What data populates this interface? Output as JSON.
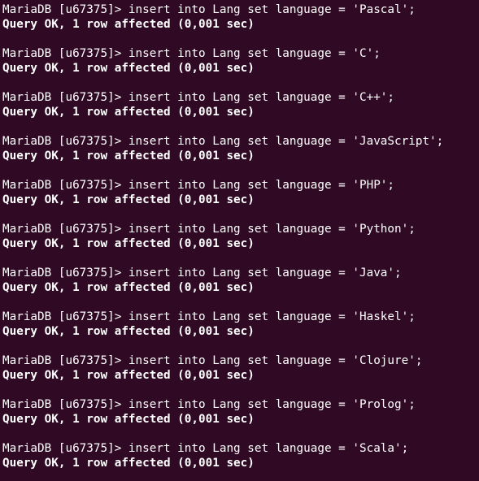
{
  "terminal": {
    "background": "#300a24",
    "foreground": "#ffffff",
    "entries": [
      {
        "prompt": "MariaDB [u67375]> insert into Lang set language = 'Pascal';",
        "result": "Query OK, 1 row affected (0,001 sec)"
      },
      {
        "prompt": "MariaDB [u67375]> insert into Lang set language = 'C';",
        "result": "Query OK, 1 row affected (0,001 sec)"
      },
      {
        "prompt": "MariaDB [u67375]> insert into Lang set language = 'C++';",
        "result": "Query OK, 1 row affected (0,001 sec)"
      },
      {
        "prompt": "MariaDB [u67375]> insert into Lang set language = 'JavaScript';",
        "result": "Query OK, 1 row affected (0,001 sec)"
      },
      {
        "prompt": "MariaDB [u67375]> insert into Lang set language = 'PHP';",
        "result": "Query OK, 1 row affected (0,001 sec)"
      },
      {
        "prompt": "MariaDB [u67375]> insert into Lang set language = 'Python';",
        "result": "Query OK, 1 row affected (0,001 sec)"
      },
      {
        "prompt": "MariaDB [u67375]> insert into Lang set language = 'Java';",
        "result": "Query OK, 1 row affected (0,001 sec)"
      },
      {
        "prompt": "MariaDB [u67375]> insert into Lang set language = 'Haskel';",
        "result": "Query OK, 1 row affected (0,001 sec)"
      },
      {
        "prompt": "MariaDB [u67375]> insert into Lang set language = 'Clojure';",
        "result": "Query OK, 1 row affected (0,001 sec)"
      },
      {
        "prompt": "MariaDB [u67375]> insert into Lang set language = 'Prolog';",
        "result": "Query OK, 1 row affected (0,001 sec)"
      },
      {
        "prompt": "MariaDB [u67375]> insert into Lang set language = 'Scala';",
        "result": "Query OK, 1 row affected (0,001 sec)"
      }
    ]
  }
}
